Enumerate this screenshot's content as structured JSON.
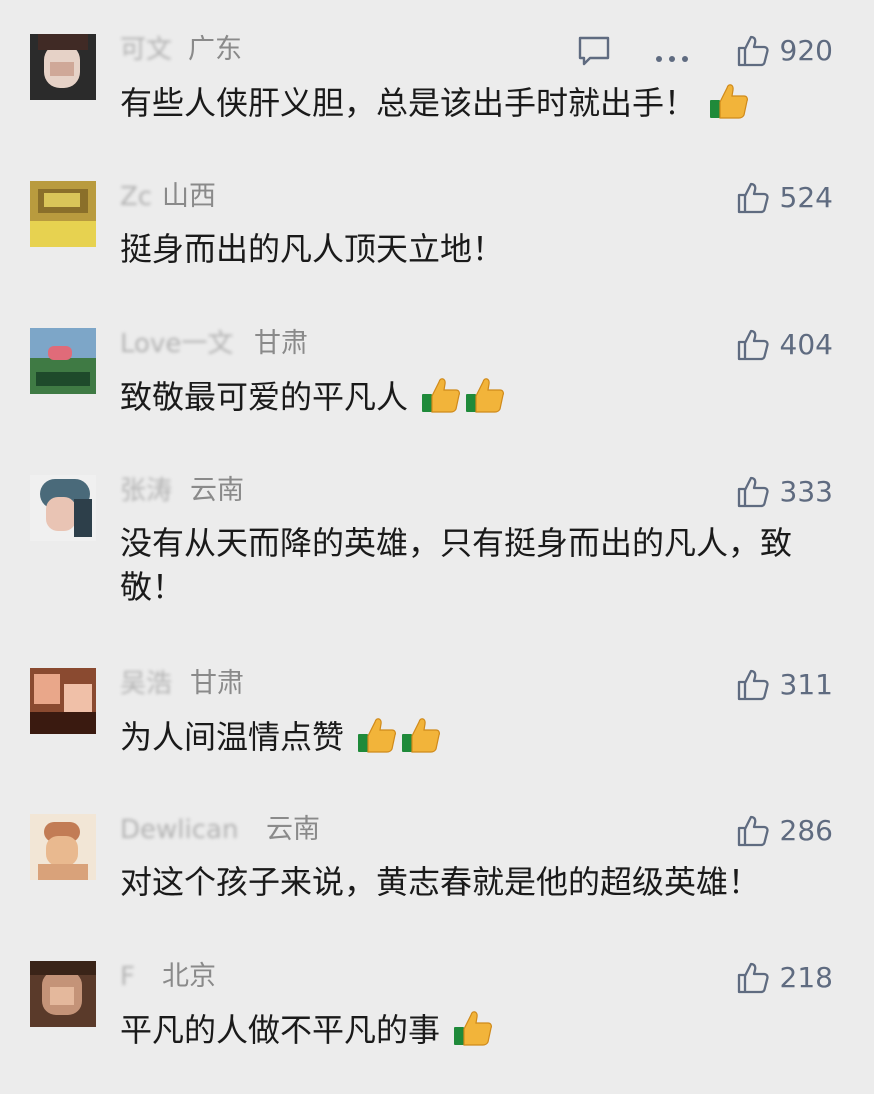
{
  "comments": [
    {
      "user": "可文",
      "region": "广东",
      "text": "有些人侠肝义胆，总是该出手时就出手！",
      "thumbs": 1,
      "likes": "920",
      "avatar": [
        "#2b2b2b",
        "#5a4a40",
        "#e6d2c7",
        "#cfa898",
        "#402a25",
        "#1a1a1a"
      ]
    },
    {
      "user": "Zc",
      "region": "山西",
      "text": "挺身而出的凡人顶天立地！",
      "thumbs": 0,
      "likes": "524",
      "avatar": [
        "#b99b3e",
        "#f3e06a",
        "#8a6f2a",
        "#d9c559",
        "#e7d250",
        "#c2aa3e"
      ]
    },
    {
      "user": "Love一文",
      "region": "甘肃",
      "text": "致敬最可爱的平凡人",
      "thumbs": 2,
      "likes": "404",
      "avatar": [
        "#7da6c8",
        "#3f7a44",
        "#e06b79",
        "#2f6a3a",
        "#4a5a6a",
        "#1e4a2b"
      ]
    },
    {
      "user": "张涛",
      "region": "云南",
      "text": "没有从天而降的英雄，只有挺身而出的凡人，致敬！",
      "thumbs": 0,
      "likes": "333",
      "avatar": [
        "#4a6a7a",
        "#f0f0f0",
        "#e9c4b4",
        "#2d3f4a",
        "#d4a790",
        "#5a7d8e"
      ]
    },
    {
      "user": "吴浩",
      "region": "甘肃",
      "text": "为人间温情点赞",
      "thumbs": 2,
      "likes": "311",
      "avatar": [
        "#8a4a30",
        "#e9a78a",
        "#5a2a1a",
        "#f0c0a8",
        "#c07a5a",
        "#3a1a10"
      ]
    },
    {
      "user": "Dewlican",
      "region": "云南",
      "text": "对这个孩子来说，黄志春就是他的超级英雄！",
      "thumbs": 0,
      "likes": "286",
      "avatar": [
        "#f2e6d6",
        "#e9b98f",
        "#c27c55",
        "#f7efe4",
        "#d9a27a",
        "#8a5a3a"
      ]
    },
    {
      "user": "F",
      "region": "北京",
      "text": "平凡的人做不平凡的事",
      "thumbs": 1,
      "likes": "218",
      "avatar": [
        "#5a3a2a",
        "#c49378",
        "#8a5a40",
        "#e4b89c",
        "#3a2418",
        "#a86f52"
      ]
    }
  ],
  "colors": {
    "accent": "#5f6b80",
    "region": "#8a8a8a",
    "text": "#1a1a1a",
    "background": "#ececec"
  }
}
